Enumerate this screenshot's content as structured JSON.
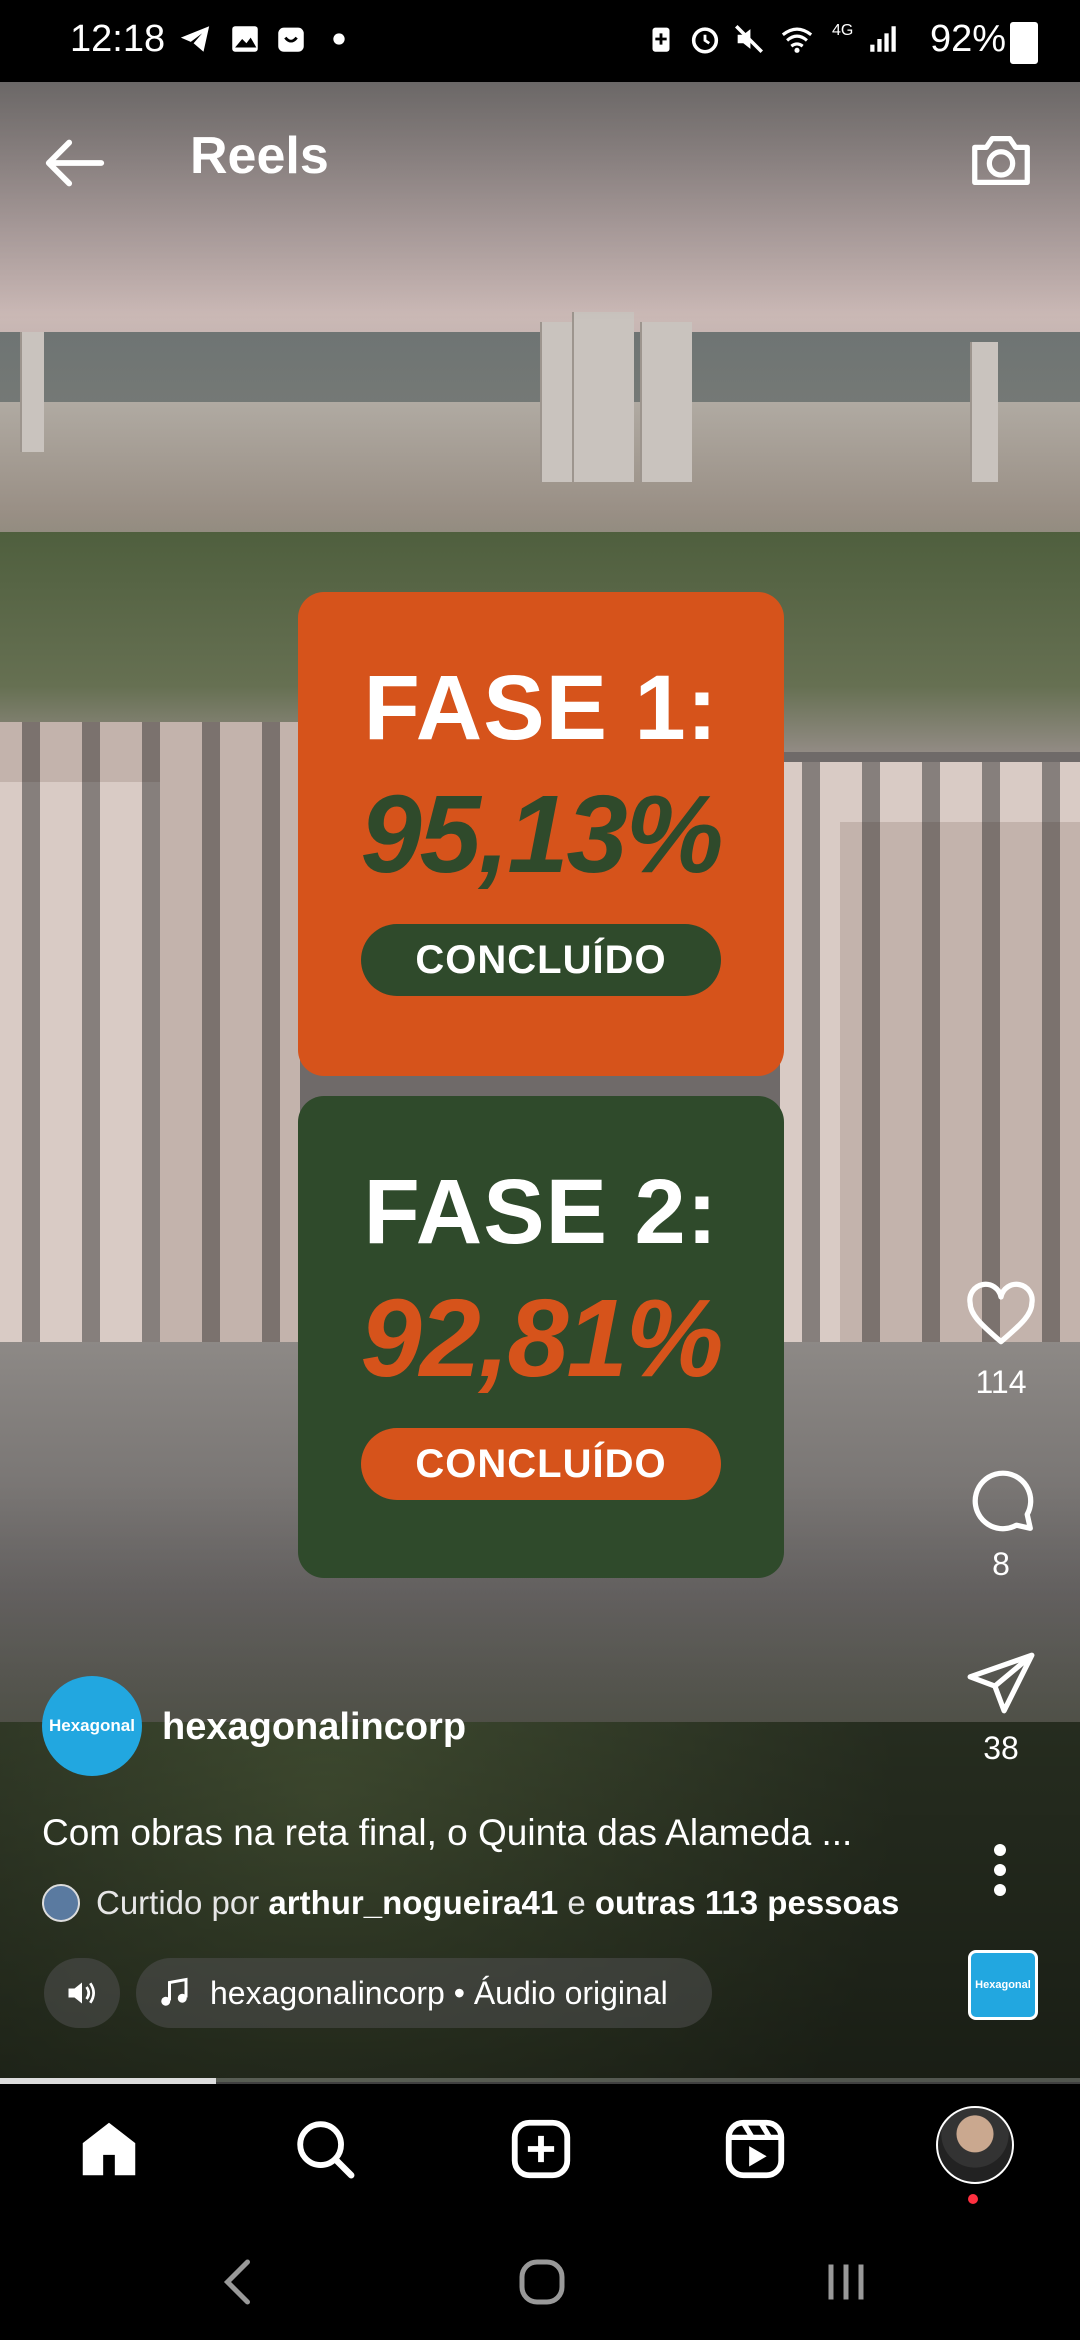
{
  "status_bar": {
    "time": "12:18",
    "battery": "92%",
    "network_label": "4G"
  },
  "header": {
    "title": "Reels"
  },
  "cards": [
    {
      "title": "FASE 1:",
      "percent": "95,13%",
      "status": "CONCLUÍDO"
    },
    {
      "title": "FASE 2:",
      "percent": "92,81%",
      "status": "CONCLUÍDO"
    }
  ],
  "actions": {
    "likes": "114",
    "comments": "8",
    "shares": "38"
  },
  "post": {
    "logo_text": "Hexagonal",
    "username": "hexagonalincorp",
    "caption": "Com obras na reta final, o Quinta das Alameda ...",
    "liked_by_prefix": "Curtido por",
    "liked_by_user": "arthur_nogueira41",
    "liked_by_connector": "e",
    "liked_by_others": "outras 113 pessoas",
    "audio": "hexagonalincorp • Áudio original",
    "audio_thumb_text": "Hexagonal"
  },
  "playback": {
    "progress_fraction": 0.2
  },
  "colors": {
    "orange": "#d6531b",
    "green": "#2f4a2b",
    "brand_blue": "#22a7e0",
    "notification": "#ff3040"
  }
}
